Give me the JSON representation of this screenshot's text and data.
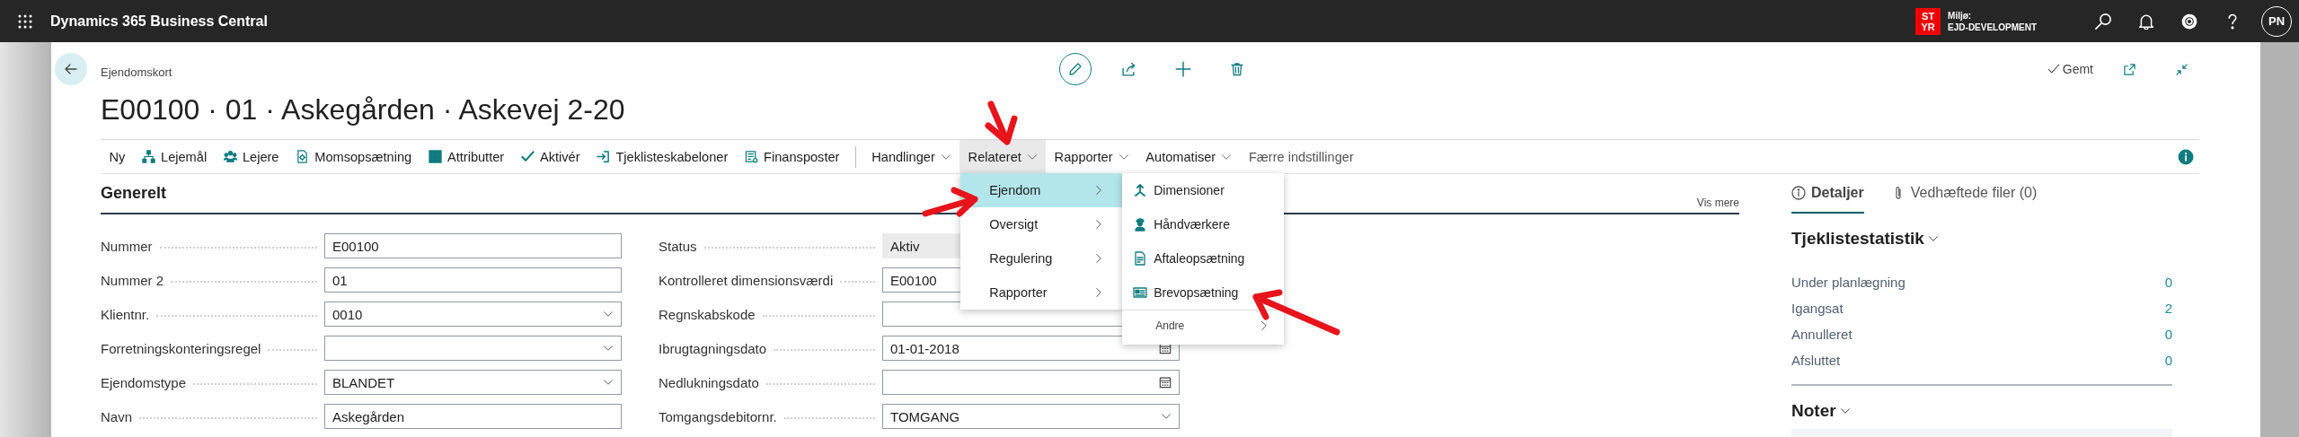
{
  "top_bar": {
    "app_title": "Dynamics 365 Business Central",
    "environment_badge": [
      "ST",
      "YR"
    ],
    "environment_label": "Miljø:",
    "environment_name": "EJD-DEVELOPMENT",
    "user_initials": "PN"
  },
  "page": {
    "breadcrumb": "Ejendomskort",
    "title": "E00100 · 01 · Askegården · Askevej 2-20",
    "save_status": "Gemt"
  },
  "actions": [
    {
      "label": "Ny",
      "kind": "button",
      "selected": false
    },
    {
      "label": "Lejemål",
      "kind": "button",
      "selected": false
    },
    {
      "label": "Lejere",
      "kind": "button",
      "selected": false
    },
    {
      "label": "Momsopsætning",
      "kind": "button",
      "selected": false
    },
    {
      "label": "Attributter",
      "kind": "button",
      "selected": false
    },
    {
      "label": "Aktivér",
      "kind": "button",
      "selected": false
    },
    {
      "label": "Tjeklisteskabeloner",
      "kind": "button",
      "selected": false
    },
    {
      "label": "Finansposter",
      "kind": "button",
      "selected": false
    },
    {
      "label": "Handlinger",
      "kind": "menu",
      "selected": false
    },
    {
      "label": "Relateret",
      "kind": "menu",
      "selected": true
    },
    {
      "label": "Rapporter",
      "kind": "menu",
      "selected": false
    },
    {
      "label": "Automatiser",
      "kind": "menu",
      "selected": false
    },
    {
      "label": "Færre indstillinger",
      "kind": "link",
      "selected": false
    }
  ],
  "menu": {
    "items": [
      {
        "label": "Ejendom",
        "selected": true
      },
      {
        "label": "Oversigt",
        "selected": false
      },
      {
        "label": "Regulering",
        "selected": false
      },
      {
        "label": "Rapporter",
        "selected": false
      }
    ]
  },
  "submenu": {
    "items": [
      {
        "label": "Dimensioner",
        "kind": "action"
      },
      {
        "label": "Håndværkere",
        "kind": "action"
      },
      {
        "label": "Aftaleopsætning",
        "kind": "action"
      },
      {
        "label": "Brevopsætning",
        "kind": "action"
      },
      {
        "label": "Andre",
        "kind": "submenu"
      }
    ]
  },
  "section": {
    "title": "Generelt",
    "more_link": "Vis mere",
    "fields_left": [
      {
        "label": "Nummer",
        "value": "E00100",
        "kind": "text"
      },
      {
        "label": "Nummer 2",
        "value": "01",
        "kind": "text"
      },
      {
        "label": "Klientnr.",
        "value": "0010",
        "kind": "dropdown"
      },
      {
        "label": "Forretningskonteringsregel",
        "kind": "dropdown"
      },
      {
        "label": "Ejendomstype",
        "value": "BLANDET",
        "kind": "dropdown"
      },
      {
        "label": "Navn",
        "value": "Askegården",
        "kind": "text"
      }
    ],
    "fields_right": [
      {
        "label": "Status",
        "value": "Aktiv",
        "kind": "readonly"
      },
      {
        "label": "Kontrolleret dimensionsværdi",
        "value": "E00100",
        "kind": "text"
      },
      {
        "label": "Regnskabskode",
        "kind": "text"
      },
      {
        "label": "Ibrugtagningsdato",
        "value": "01-01-2018",
        "kind": "date"
      },
      {
        "label": "Nedlukningsdato",
        "kind": "date"
      },
      {
        "label": "Tomgangsdebitornr.",
        "value": "TOMGANG",
        "kind": "dropdown"
      }
    ]
  },
  "fact_box": {
    "tabs": [
      {
        "label": "Detaljer",
        "selected": true
      },
      {
        "label": "Vedhæftede filer (0)",
        "selected": false
      }
    ],
    "stats_title": "Tjeklistestatistik",
    "stats": [
      {
        "label": "Under planlægning",
        "value": "0"
      },
      {
        "label": "Igangsat",
        "value": "2"
      },
      {
        "label": "Annulleret",
        "value": "0"
      },
      {
        "label": "Afsluttet",
        "value": "0"
      }
    ],
    "notes_title": "Noter"
  }
}
